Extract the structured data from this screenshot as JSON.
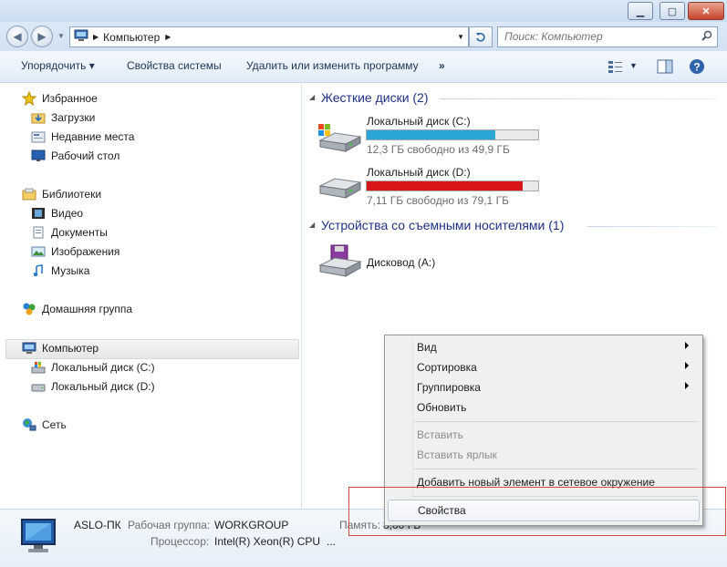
{
  "titlebar": {
    "minimize": "▁",
    "maximize": "▢",
    "close": "✕"
  },
  "address": {
    "path": [
      "Компьютер"
    ],
    "refresh_icon": "refresh-icon"
  },
  "search": {
    "placeholder": "Поиск: Компьютер"
  },
  "toolbar": {
    "organize": "Упорядочить ▾",
    "system_properties": "Свойства системы",
    "uninstall": "Удалить или изменить программу",
    "more": "»"
  },
  "nav": {
    "favorites": "Избранное",
    "downloads": "Загрузки",
    "recent": "Недавние места",
    "desktop": "Рабочий стол",
    "libraries": "Библиотеки",
    "video": "Видео",
    "documents": "Документы",
    "pictures": "Изображения",
    "music": "Музыка",
    "homegroup": "Домашняя группа",
    "computer": "Компьютер",
    "drive_c": "Локальный диск (C:)",
    "drive_d": "Локальный диск (D:)",
    "network": "Сеть"
  },
  "content": {
    "hdd_header": "Жесткие диски (2)",
    "drives": [
      {
        "name": "Локальный диск (C:)",
        "free": "12,3 ГБ свободно из 49,9 ГБ",
        "used_fraction": 0.75,
        "color": "#2aa5d6"
      },
      {
        "name": "Локальный диск (D:)",
        "free": "7,11 ГБ свободно из 79,1 ГБ",
        "used_fraction": 0.91,
        "color": "#d8161a"
      }
    ],
    "removable_header": "Устройства со съемными носителями (1)",
    "floppy": "Дисковод (A:)"
  },
  "details": {
    "computer_name": "ASLO-ПК",
    "workgroup_label": "Рабочая группа:",
    "workgroup_value": "WORKGROUP",
    "memory_label": "Память:",
    "memory_value": "8,00 ГБ",
    "cpu_label": "Процессор:",
    "cpu_value": "Intel(R) Xeon(R) CPU",
    "cpu_more": "..."
  },
  "context_menu": {
    "view": "Вид",
    "sort": "Сортировка",
    "group": "Группировка",
    "refresh": "Обновить",
    "paste": "Вставить",
    "paste_shortcut": "Вставить ярлык",
    "add_network": "Добавить новый элемент в сетевое окружение",
    "properties": "Свойства"
  }
}
